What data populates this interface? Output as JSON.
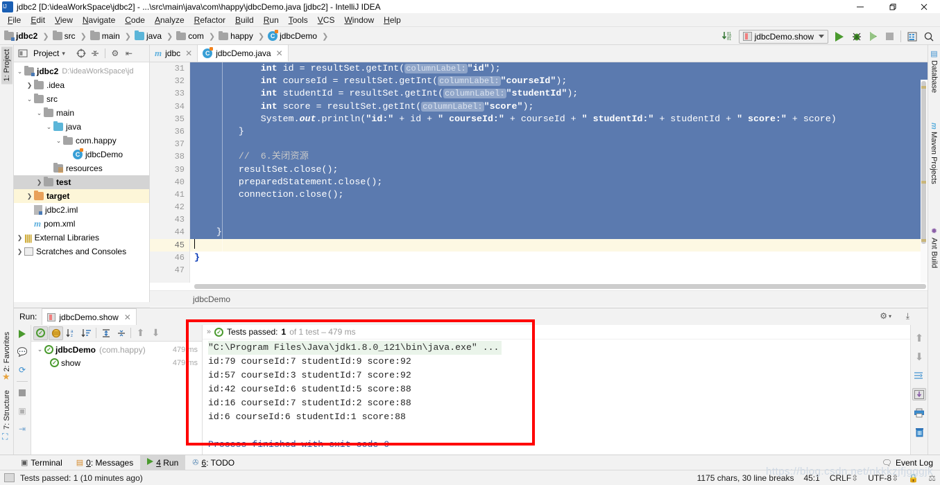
{
  "window": {
    "title": "jdbc2 [D:\\ideaWorkSpace\\jdbc2] - ...\\src\\main\\java\\com\\happy\\jdbcDemo.java [jdbc2] - IntelliJ IDEA",
    "minimize": "—",
    "restore": "❐",
    "close": "✕"
  },
  "menu": [
    "File",
    "Edit",
    "View",
    "Navigate",
    "Code",
    "Analyze",
    "Refactor",
    "Build",
    "Run",
    "Tools",
    "VCS",
    "Window",
    "Help"
  ],
  "breadcrumb": [
    {
      "label": "jdbc2",
      "icon": "module-folder-icon"
    },
    {
      "label": "src",
      "icon": "folder-icon"
    },
    {
      "label": "main",
      "icon": "folder-icon"
    },
    {
      "label": "java",
      "icon": "source-folder-icon"
    },
    {
      "label": "com",
      "icon": "package-icon"
    },
    {
      "label": "happy",
      "icon": "package-icon"
    },
    {
      "label": "jdbcDemo",
      "icon": "java-class-icon"
    }
  ],
  "toolbar": {
    "run_config": "jdbcDemo.show",
    "run_button": "run-icon",
    "debug_button": "debug-icon",
    "coverage_button": "run-coverage-icon",
    "stop_button": "stop-icon",
    "layout_button": "layout-icon",
    "search_button": "search-icon",
    "update_button": "update-project-icon"
  },
  "left_strip": {
    "project": "1: Project",
    "favorites": "2: Favorites",
    "structure": "7: Structure"
  },
  "right_strip": {
    "database": "Database",
    "maven": "Maven Projects",
    "ant": "Ant Build"
  },
  "project_panel": {
    "header_label": "Project",
    "tree": [
      {
        "label": "jdbc2",
        "path": "D:\\ideaWorkSpace\\jd",
        "icon": "module-folder-icon",
        "arrow": "expanded",
        "indent": 0,
        "bold": true,
        "state": "none"
      },
      {
        "label": ".idea",
        "path": "",
        "icon": "folder-icon",
        "arrow": "collapsed",
        "indent": 1,
        "bold": false,
        "state": "none"
      },
      {
        "label": "src",
        "path": "",
        "icon": "folder-icon",
        "arrow": "expanded",
        "indent": 1,
        "bold": false,
        "state": "none"
      },
      {
        "label": "main",
        "path": "",
        "icon": "folder-icon",
        "arrow": "expanded",
        "indent": 2,
        "bold": false,
        "state": "none"
      },
      {
        "label": "java",
        "path": "",
        "icon": "source-folder-icon",
        "arrow": "expanded",
        "indent": 3,
        "bold": false,
        "state": "none"
      },
      {
        "label": "com.happy",
        "path": "",
        "icon": "package-icon",
        "arrow": "expanded",
        "indent": 4,
        "bold": false,
        "state": "none"
      },
      {
        "label": "jdbcDemo",
        "path": "",
        "icon": "java-class-icon",
        "arrow": "none",
        "indent": 5,
        "bold": false,
        "state": "none"
      },
      {
        "label": "resources",
        "path": "",
        "icon": "resources-folder-icon",
        "arrow": "none",
        "indent": 3,
        "bold": false,
        "state": "none"
      },
      {
        "label": "test",
        "path": "",
        "icon": "folder-icon",
        "arrow": "collapsed",
        "indent": 2,
        "bold": true,
        "state": "selected-gray"
      },
      {
        "label": "target",
        "path": "",
        "icon": "target-folder-icon",
        "arrow": "collapsed",
        "indent": 1,
        "bold": true,
        "state": "selected-yellow"
      },
      {
        "label": "jdbc2.iml",
        "path": "",
        "icon": "iml-file-icon",
        "arrow": "none",
        "indent": 1,
        "bold": false,
        "state": "none"
      },
      {
        "label": "pom.xml",
        "path": "",
        "icon": "maven-pom-icon",
        "arrow": "none",
        "indent": 1,
        "bold": false,
        "state": "none"
      },
      {
        "label": "External Libraries",
        "path": "",
        "icon": "libraries-icon",
        "arrow": "collapsed",
        "indent": 0,
        "bold": false,
        "state": "none"
      },
      {
        "label": "Scratches and Consoles",
        "path": "",
        "icon": "scratches-icon",
        "arrow": "collapsed",
        "indent": 0,
        "bold": false,
        "state": "none"
      }
    ]
  },
  "editor": {
    "tabs": [
      {
        "label": "jdbc",
        "icon": "maven-module-icon",
        "active": false
      },
      {
        "label": "jdbcDemo.java",
        "icon": "java-class-icon",
        "active": true
      }
    ],
    "first_line_number": 31,
    "line_numbers": [
      31,
      32,
      33,
      34,
      35,
      36,
      37,
      38,
      39,
      40,
      41,
      42,
      43,
      44,
      45,
      46,
      47
    ],
    "current_line": 45,
    "breadcrumb_bottom": "jdbcDemo",
    "lines": [
      {
        "n": 31,
        "sel": true,
        "parts": [
          {
            "t": "            ",
            "c": "plain"
          },
          {
            "t": "int",
            "c": "kw"
          },
          {
            "t": " id = resultSet.getInt(",
            "c": "plain"
          },
          {
            "t": "columnLabel:",
            "c": "hint"
          },
          {
            "t": "\"id\"",
            "c": "str"
          },
          {
            "t": ");",
            "c": "plain"
          }
        ]
      },
      {
        "n": 32,
        "sel": true,
        "parts": [
          {
            "t": "            ",
            "c": "plain"
          },
          {
            "t": "int",
            "c": "kw"
          },
          {
            "t": " courseId = resultSet.getInt(",
            "c": "plain"
          },
          {
            "t": "columnLabel:",
            "c": "hint"
          },
          {
            "t": "\"courseId\"",
            "c": "str"
          },
          {
            "t": ");",
            "c": "plain"
          }
        ]
      },
      {
        "n": 33,
        "sel": true,
        "parts": [
          {
            "t": "            ",
            "c": "plain"
          },
          {
            "t": "int",
            "c": "kw"
          },
          {
            "t": " studentId = resultSet.getInt(",
            "c": "plain"
          },
          {
            "t": "columnLabel:",
            "c": "hint"
          },
          {
            "t": "\"studentId\"",
            "c": "str"
          },
          {
            "t": ");",
            "c": "plain"
          }
        ]
      },
      {
        "n": 34,
        "sel": true,
        "parts": [
          {
            "t": "            ",
            "c": "plain"
          },
          {
            "t": "int",
            "c": "kw"
          },
          {
            "t": " score = resultSet.getInt(",
            "c": "plain"
          },
          {
            "t": "columnLabel:",
            "c": "hint"
          },
          {
            "t": "\"score\"",
            "c": "str"
          },
          {
            "t": ");",
            "c": "plain"
          }
        ]
      },
      {
        "n": 35,
        "sel": true,
        "parts": [
          {
            "t": "            System.",
            "c": "plain"
          },
          {
            "t": "out",
            "c": "fld"
          },
          {
            "t": ".println(",
            "c": "plain"
          },
          {
            "t": "\"id:\"",
            "c": "str"
          },
          {
            "t": " + id + ",
            "c": "plain"
          },
          {
            "t": "\" courseId:\"",
            "c": "str"
          },
          {
            "t": " + courseId + ",
            "c": "plain"
          },
          {
            "t": "\" studentId:\"",
            "c": "str"
          },
          {
            "t": " + studentId + ",
            "c": "plain"
          },
          {
            "t": "\" score:\"",
            "c": "str"
          },
          {
            "t": " + score)",
            "c": "plain"
          }
        ]
      },
      {
        "n": 36,
        "sel": true,
        "parts": [
          {
            "t": "        }",
            "c": "plain"
          }
        ]
      },
      {
        "n": 37,
        "sel": true,
        "parts": [
          {
            "t": "",
            "c": "plain"
          }
        ]
      },
      {
        "n": 38,
        "sel": true,
        "parts": [
          {
            "t": "        ",
            "c": "plain"
          },
          {
            "t": "//  6.关闭资源",
            "c": "cmt"
          }
        ]
      },
      {
        "n": 39,
        "sel": true,
        "parts": [
          {
            "t": "        resultSet.close();",
            "c": "plain"
          }
        ]
      },
      {
        "n": 40,
        "sel": true,
        "parts": [
          {
            "t": "        preparedStatement.close();",
            "c": "plain"
          }
        ]
      },
      {
        "n": 41,
        "sel": true,
        "parts": [
          {
            "t": "        connection.close();",
            "c": "plain"
          }
        ]
      },
      {
        "n": 42,
        "sel": true,
        "parts": [
          {
            "t": "",
            "c": "plain"
          }
        ]
      },
      {
        "n": 43,
        "sel": true,
        "parts": [
          {
            "t": "",
            "c": "plain"
          }
        ]
      },
      {
        "n": 44,
        "sel": true,
        "parts": [
          {
            "t": "    }",
            "c": "plain"
          }
        ]
      },
      {
        "n": 45,
        "sel": false,
        "cur": true,
        "parts": [
          {
            "t": "",
            "c": "plain"
          }
        ]
      },
      {
        "n": 46,
        "sel": false,
        "parts": [
          {
            "t": "}",
            "c": "kw2"
          }
        ]
      },
      {
        "n": 47,
        "sel": false,
        "parts": [
          {
            "t": "",
            "c": "plain"
          }
        ]
      }
    ]
  },
  "run_panel": {
    "run_label": "Run:",
    "tab_label": "jdbcDemo.show",
    "tests": {
      "root": {
        "name": "jdbcDemo",
        "package": "(com.happy)",
        "duration": "479 ms"
      },
      "child": {
        "name": "show",
        "duration": "479 ms"
      }
    },
    "status": {
      "prefix": "Tests passed:",
      "count": "1",
      "suffix": "of 1 test – 479 ms"
    },
    "console": [
      {
        "text": "\"C:\\Program Files\\Java\\jdk1.8.0_121\\bin\\java.exe\" ...",
        "style": "command"
      },
      {
        "text": "id:79 courseId:7 studentId:9 score:92",
        "style": "out"
      },
      {
        "text": "id:57 courseId:3 studentId:7 score:92",
        "style": "out"
      },
      {
        "text": "id:42 courseId:6 studentId:5 score:88",
        "style": "out"
      },
      {
        "text": "id:16 courseId:7 studentId:2 score:88",
        "style": "out"
      },
      {
        "text": "id:6 courseId:6 studentId:1 score:88",
        "style": "out"
      },
      {
        "text": "",
        "style": "out"
      },
      {
        "text": "Process finished with exit code 0",
        "style": "exit"
      }
    ]
  },
  "bottom_tabs": [
    {
      "num": "",
      "label": "Terminal",
      "icon": "terminal-icon",
      "active": false
    },
    {
      "num": "0",
      "label": ": Messages",
      "icon": "messages-icon",
      "active": false
    },
    {
      "num": "4",
      "label": " Run",
      "icon": "run-icon",
      "active": true
    },
    {
      "num": "6",
      "label": ": TODO",
      "icon": "todo-icon",
      "active": false
    }
  ],
  "event_log": "Event Log",
  "statusbar": {
    "message": "Tests passed: 1 (10 minutes ago)",
    "chars": "1175 chars, 30 line breaks",
    "caret": "45:1",
    "line_sep": "CRLF",
    "encoding": "UTF-8"
  },
  "watermark": "https://blog.csdn.net/nkkkzjfjgggjk",
  "colors": {
    "selection": "#5b7aaf",
    "current_line": "#fdf8e3",
    "accent_green": "#4a9a2e",
    "red_box": "#ff0000"
  }
}
